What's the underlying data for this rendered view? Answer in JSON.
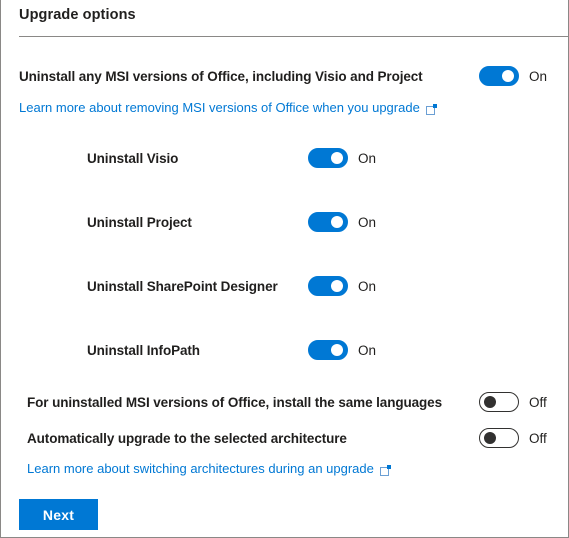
{
  "panel": {
    "title": "Upgrade options",
    "accent_color": "#0078d4",
    "border_color": "#8a8886",
    "text_color": "#201f1e"
  },
  "options": {
    "uninstall_msi": {
      "label": "Uninstall any MSI versions of Office, including Visio and Project",
      "state": "On",
      "checked": true
    },
    "uninstall_visio": {
      "label": "Uninstall Visio",
      "state": "On",
      "checked": true
    },
    "uninstall_project": {
      "label": "Uninstall Project",
      "state": "On",
      "checked": true
    },
    "uninstall_sharepoint_designer": {
      "label": "Uninstall SharePoint Designer",
      "state": "On",
      "checked": true
    },
    "uninstall_infopath": {
      "label": "Uninstall InfoPath",
      "state": "On",
      "checked": true
    },
    "same_languages": {
      "label": "For uninstalled MSI versions of Office, install the same languages",
      "state": "Off",
      "checked": false
    },
    "auto_upgrade_architecture": {
      "label": "Automatically upgrade to the selected architecture",
      "state": "Off",
      "checked": false
    }
  },
  "links": {
    "removing_msi": {
      "label": "Learn more about removing MSI versions of Office when you upgrade",
      "icon": "external-link-icon"
    },
    "switching_architectures": {
      "label": "Learn more about switching architectures during an upgrade",
      "icon": "external-link-icon"
    }
  },
  "footer": {
    "next_label": "Next"
  }
}
